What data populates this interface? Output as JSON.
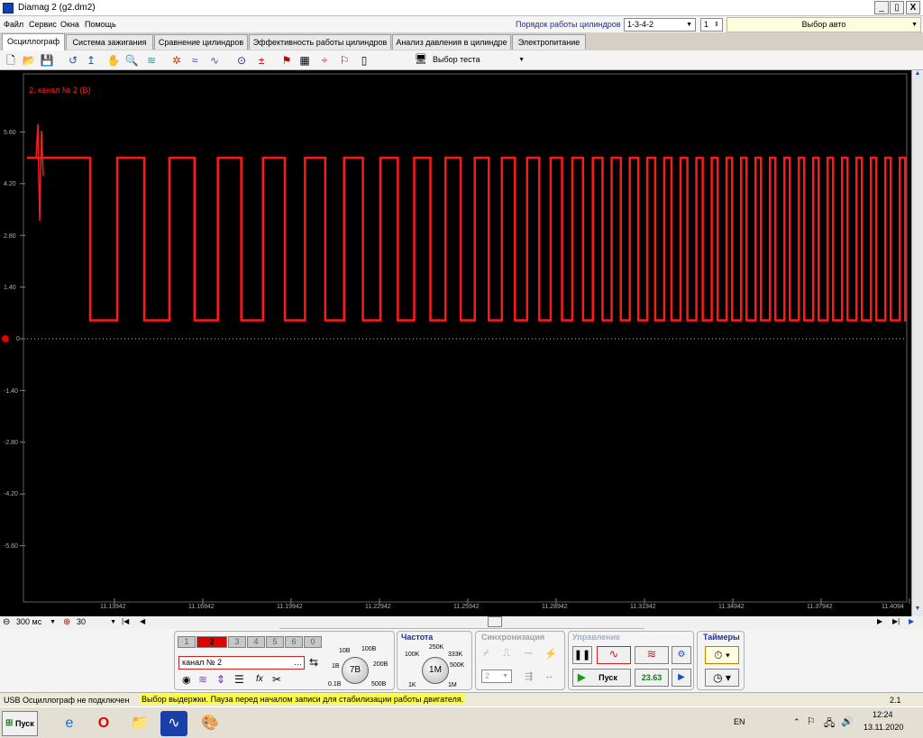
{
  "window": {
    "title": "Diamag 2 (g2.dm2)",
    "min": "_",
    "max": "▯",
    "close": "X",
    "restore": "_",
    "restore2": "▯",
    "close2": "X"
  },
  "menu": [
    "Файл",
    "Сервис",
    "Окна",
    "Помощь"
  ],
  "cylinders": {
    "label": "Порядок работы цилиндров",
    "order": "1-3-4-2",
    "count": "1",
    "auto": "Выбор авто"
  },
  "tabs": [
    "Осциллограф",
    "Система зажигания",
    "Сравнение цилиндров",
    "Эффективность работы цилиндров",
    "Анализ давления в цилиндре",
    "Электропитание"
  ],
  "toolbar": {
    "test_select": "Выбор теста"
  },
  "scope": {
    "channel_label": "2. канал № 2 (В)",
    "trace_color": "#ff1a1a",
    "y_ticks": [
      "5.60",
      "4.20",
      "2.80",
      "1.40",
      "0",
      "-1.40",
      "-2.80",
      "-4.20",
      "-5.60"
    ],
    "x_ticks": [
      "11.13942",
      "11.16942",
      "11.19942",
      "11.22942",
      "11.25942",
      "11.28942",
      "11.31942",
      "11.34942",
      "11.37942",
      "11.4094"
    ],
    "high_level": 4.9,
    "low_level": 0.5
  },
  "bottom_bar": {
    "timebase": "300 мс",
    "zoom": "30"
  },
  "panel": {
    "channels": [
      "1",
      "2",
      "3",
      "4",
      "5",
      "6",
      "0"
    ],
    "channel_name": "канал № 2",
    "voltage": {
      "value": "7В",
      "ticks": [
        "10В",
        "100В",
        "1В",
        "200В",
        "0.1В",
        "500В"
      ]
    },
    "freq": {
      "title": "Частота",
      "value": "1M",
      "ticks": [
        "250K",
        "100K",
        "333K",
        "500K",
        "1K",
        "1M"
      ]
    },
    "sync": {
      "title": "Синхронизация",
      "value": "2"
    },
    "control": {
      "title": "Управление",
      "start": "Пуск",
      "rpm": "23.63"
    },
    "timers": {
      "title": "Таймеры"
    }
  },
  "status": {
    "left": "USB Осциллограф не подключен",
    "message": "Выбор выдержки. Пауза перед началом записи для стабилизации работы двигателя.",
    "right": "2.1"
  },
  "taskbar": {
    "start": "Пуск",
    "lang": "EN",
    "time": "12:24",
    "date": "13.11.2020"
  }
}
